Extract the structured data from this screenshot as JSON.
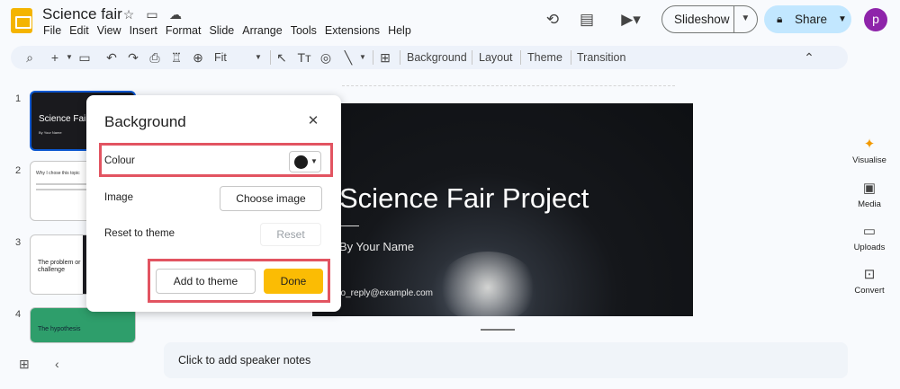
{
  "app": {
    "doc_title": "Science fair",
    "menu": [
      "File",
      "Edit",
      "View",
      "Insert",
      "Format",
      "Slide",
      "Arrange",
      "Tools",
      "Extensions",
      "Help"
    ],
    "slideshow_label": "Slideshow",
    "share_label": "Share",
    "avatar_letter": "p"
  },
  "toolbar": {
    "zoom_value": "Fit",
    "background_label": "Background",
    "layout_label": "Layout",
    "theme_label": "Theme",
    "transition_label": "Transition"
  },
  "filmstrip": {
    "slides": [
      {
        "number": "1",
        "title": "Science Fair",
        "subtitle": "By Your Name"
      },
      {
        "number": "2",
        "title": "Why I chose this topic"
      },
      {
        "number": "3",
        "title": "The problem or challenge"
      },
      {
        "number": "4",
        "title": "The hypothesis"
      }
    ]
  },
  "slide": {
    "title": "Science Fair Project",
    "subtitle": "By Your Name",
    "email": "no_reply@example.com"
  },
  "notes": {
    "placeholder": "Click to add speaker notes"
  },
  "side_panel": {
    "items": [
      {
        "label": "Visualise",
        "icon": "sparkle-icon"
      },
      {
        "label": "Media",
        "icon": "media-icon"
      },
      {
        "label": "Uploads",
        "icon": "folder-icon"
      },
      {
        "label": "Convert",
        "icon": "convert-icon"
      }
    ]
  },
  "dialog": {
    "title": "Background",
    "colour_label": "Colour",
    "colour_value": "#1c1c1c",
    "image_label": "Image",
    "choose_image_label": "Choose image",
    "reset_label": "Reset to theme",
    "reset_button": "Reset",
    "add_to_theme_label": "Add to theme",
    "done_label": "Done"
  },
  "colors": {
    "accent_yellow": "#fbbc04",
    "share_blue": "#c2e7ff",
    "highlight_red": "#e25461",
    "avatar_purple": "#8e24aa"
  }
}
